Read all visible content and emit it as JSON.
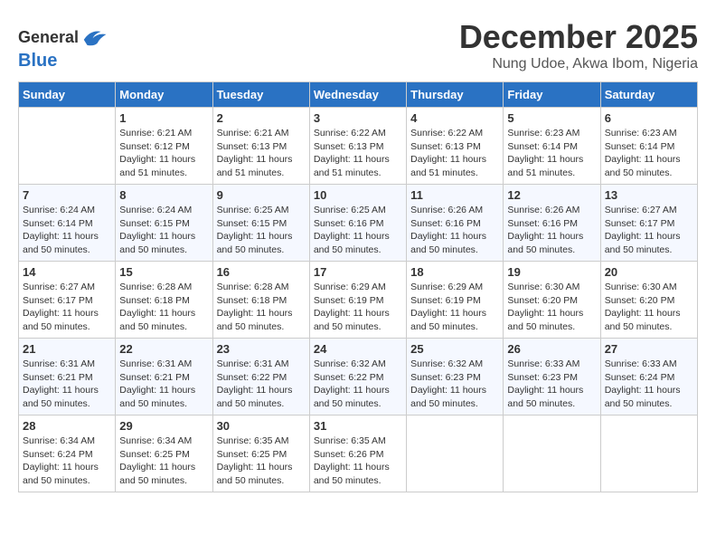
{
  "header": {
    "logo_line1": "General",
    "logo_line2": "Blue",
    "month_title": "December 2025",
    "location": "Nung Udoe, Akwa Ibom, Nigeria"
  },
  "weekdays": [
    "Sunday",
    "Monday",
    "Tuesday",
    "Wednesday",
    "Thursday",
    "Friday",
    "Saturday"
  ],
  "weeks": [
    [
      {
        "day": "",
        "sunrise": "",
        "sunset": "",
        "daylight": ""
      },
      {
        "day": "1",
        "sunrise": "Sunrise: 6:21 AM",
        "sunset": "Sunset: 6:12 PM",
        "daylight": "Daylight: 11 hours and 51 minutes."
      },
      {
        "day": "2",
        "sunrise": "Sunrise: 6:21 AM",
        "sunset": "Sunset: 6:13 PM",
        "daylight": "Daylight: 11 hours and 51 minutes."
      },
      {
        "day": "3",
        "sunrise": "Sunrise: 6:22 AM",
        "sunset": "Sunset: 6:13 PM",
        "daylight": "Daylight: 11 hours and 51 minutes."
      },
      {
        "day": "4",
        "sunrise": "Sunrise: 6:22 AM",
        "sunset": "Sunset: 6:13 PM",
        "daylight": "Daylight: 11 hours and 51 minutes."
      },
      {
        "day": "5",
        "sunrise": "Sunrise: 6:23 AM",
        "sunset": "Sunset: 6:14 PM",
        "daylight": "Daylight: 11 hours and 51 minutes."
      },
      {
        "day": "6",
        "sunrise": "Sunrise: 6:23 AM",
        "sunset": "Sunset: 6:14 PM",
        "daylight": "Daylight: 11 hours and 50 minutes."
      }
    ],
    [
      {
        "day": "7",
        "sunrise": "Sunrise: 6:24 AM",
        "sunset": "Sunset: 6:14 PM",
        "daylight": "Daylight: 11 hours and 50 minutes."
      },
      {
        "day": "8",
        "sunrise": "Sunrise: 6:24 AM",
        "sunset": "Sunset: 6:15 PM",
        "daylight": "Daylight: 11 hours and 50 minutes."
      },
      {
        "day": "9",
        "sunrise": "Sunrise: 6:25 AM",
        "sunset": "Sunset: 6:15 PM",
        "daylight": "Daylight: 11 hours and 50 minutes."
      },
      {
        "day": "10",
        "sunrise": "Sunrise: 6:25 AM",
        "sunset": "Sunset: 6:16 PM",
        "daylight": "Daylight: 11 hours and 50 minutes."
      },
      {
        "day": "11",
        "sunrise": "Sunrise: 6:26 AM",
        "sunset": "Sunset: 6:16 PM",
        "daylight": "Daylight: 11 hours and 50 minutes."
      },
      {
        "day": "12",
        "sunrise": "Sunrise: 6:26 AM",
        "sunset": "Sunset: 6:16 PM",
        "daylight": "Daylight: 11 hours and 50 minutes."
      },
      {
        "day": "13",
        "sunrise": "Sunrise: 6:27 AM",
        "sunset": "Sunset: 6:17 PM",
        "daylight": "Daylight: 11 hours and 50 minutes."
      }
    ],
    [
      {
        "day": "14",
        "sunrise": "Sunrise: 6:27 AM",
        "sunset": "Sunset: 6:17 PM",
        "daylight": "Daylight: 11 hours and 50 minutes."
      },
      {
        "day": "15",
        "sunrise": "Sunrise: 6:28 AM",
        "sunset": "Sunset: 6:18 PM",
        "daylight": "Daylight: 11 hours and 50 minutes."
      },
      {
        "day": "16",
        "sunrise": "Sunrise: 6:28 AM",
        "sunset": "Sunset: 6:18 PM",
        "daylight": "Daylight: 11 hours and 50 minutes."
      },
      {
        "day": "17",
        "sunrise": "Sunrise: 6:29 AM",
        "sunset": "Sunset: 6:19 PM",
        "daylight": "Daylight: 11 hours and 50 minutes."
      },
      {
        "day": "18",
        "sunrise": "Sunrise: 6:29 AM",
        "sunset": "Sunset: 6:19 PM",
        "daylight": "Daylight: 11 hours and 50 minutes."
      },
      {
        "day": "19",
        "sunrise": "Sunrise: 6:30 AM",
        "sunset": "Sunset: 6:20 PM",
        "daylight": "Daylight: 11 hours and 50 minutes."
      },
      {
        "day": "20",
        "sunrise": "Sunrise: 6:30 AM",
        "sunset": "Sunset: 6:20 PM",
        "daylight": "Daylight: 11 hours and 50 minutes."
      }
    ],
    [
      {
        "day": "21",
        "sunrise": "Sunrise: 6:31 AM",
        "sunset": "Sunset: 6:21 PM",
        "daylight": "Daylight: 11 hours and 50 minutes."
      },
      {
        "day": "22",
        "sunrise": "Sunrise: 6:31 AM",
        "sunset": "Sunset: 6:21 PM",
        "daylight": "Daylight: 11 hours and 50 minutes."
      },
      {
        "day": "23",
        "sunrise": "Sunrise: 6:31 AM",
        "sunset": "Sunset: 6:22 PM",
        "daylight": "Daylight: 11 hours and 50 minutes."
      },
      {
        "day": "24",
        "sunrise": "Sunrise: 6:32 AM",
        "sunset": "Sunset: 6:22 PM",
        "daylight": "Daylight: 11 hours and 50 minutes."
      },
      {
        "day": "25",
        "sunrise": "Sunrise: 6:32 AM",
        "sunset": "Sunset: 6:23 PM",
        "daylight": "Daylight: 11 hours and 50 minutes."
      },
      {
        "day": "26",
        "sunrise": "Sunrise: 6:33 AM",
        "sunset": "Sunset: 6:23 PM",
        "daylight": "Daylight: 11 hours and 50 minutes."
      },
      {
        "day": "27",
        "sunrise": "Sunrise: 6:33 AM",
        "sunset": "Sunset: 6:24 PM",
        "daylight": "Daylight: 11 hours and 50 minutes."
      }
    ],
    [
      {
        "day": "28",
        "sunrise": "Sunrise: 6:34 AM",
        "sunset": "Sunset: 6:24 PM",
        "daylight": "Daylight: 11 hours and 50 minutes."
      },
      {
        "day": "29",
        "sunrise": "Sunrise: 6:34 AM",
        "sunset": "Sunset: 6:25 PM",
        "daylight": "Daylight: 11 hours and 50 minutes."
      },
      {
        "day": "30",
        "sunrise": "Sunrise: 6:35 AM",
        "sunset": "Sunset: 6:25 PM",
        "daylight": "Daylight: 11 hours and 50 minutes."
      },
      {
        "day": "31",
        "sunrise": "Sunrise: 6:35 AM",
        "sunset": "Sunset: 6:26 PM",
        "daylight": "Daylight: 11 hours and 50 minutes."
      },
      {
        "day": "",
        "sunrise": "",
        "sunset": "",
        "daylight": ""
      },
      {
        "day": "",
        "sunrise": "",
        "sunset": "",
        "daylight": ""
      },
      {
        "day": "",
        "sunrise": "",
        "sunset": "",
        "daylight": ""
      }
    ]
  ]
}
